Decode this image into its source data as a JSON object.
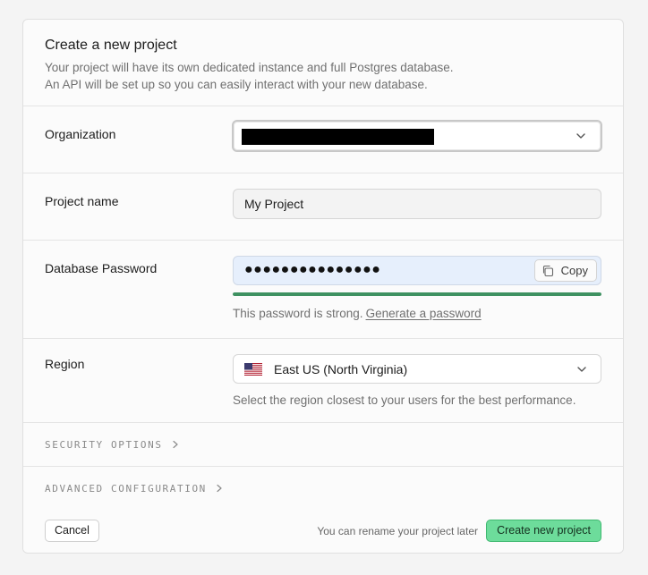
{
  "header": {
    "title": "Create a new project",
    "description_line1": "Your project will have its own dedicated instance and full Postgres database.",
    "description_line2": "An API will be set up so you can easily interact with your new database."
  },
  "organization": {
    "label": "Organization",
    "value_redacted": true,
    "icon": "chevron-down-icon"
  },
  "project_name": {
    "label": "Project name",
    "value": "My Project"
  },
  "password": {
    "label": "Database Password",
    "masked_value": "●●●●●●●●●●●●●●●",
    "copy_label": "Copy",
    "strength_fraction": 1.0,
    "strength_color": "#3e9161",
    "strength_text": "This password is strong.",
    "generate_link": "Generate a password"
  },
  "region": {
    "label": "Region",
    "value": "East US (North Virginia)",
    "flag_icon": "us-flag-icon",
    "hint": "Select the region closest to your users for the best performance."
  },
  "sections": {
    "security": "SECURITY OPTIONS",
    "advanced": "ADVANCED CONFIGURATION"
  },
  "footer": {
    "cancel_label": "Cancel",
    "note": "You can rename your project later",
    "create_label": "Create new project"
  },
  "colors": {
    "accent": "#6ddc9b",
    "accent_border": "#3fb870",
    "password_field_bg": "#e6effc"
  }
}
